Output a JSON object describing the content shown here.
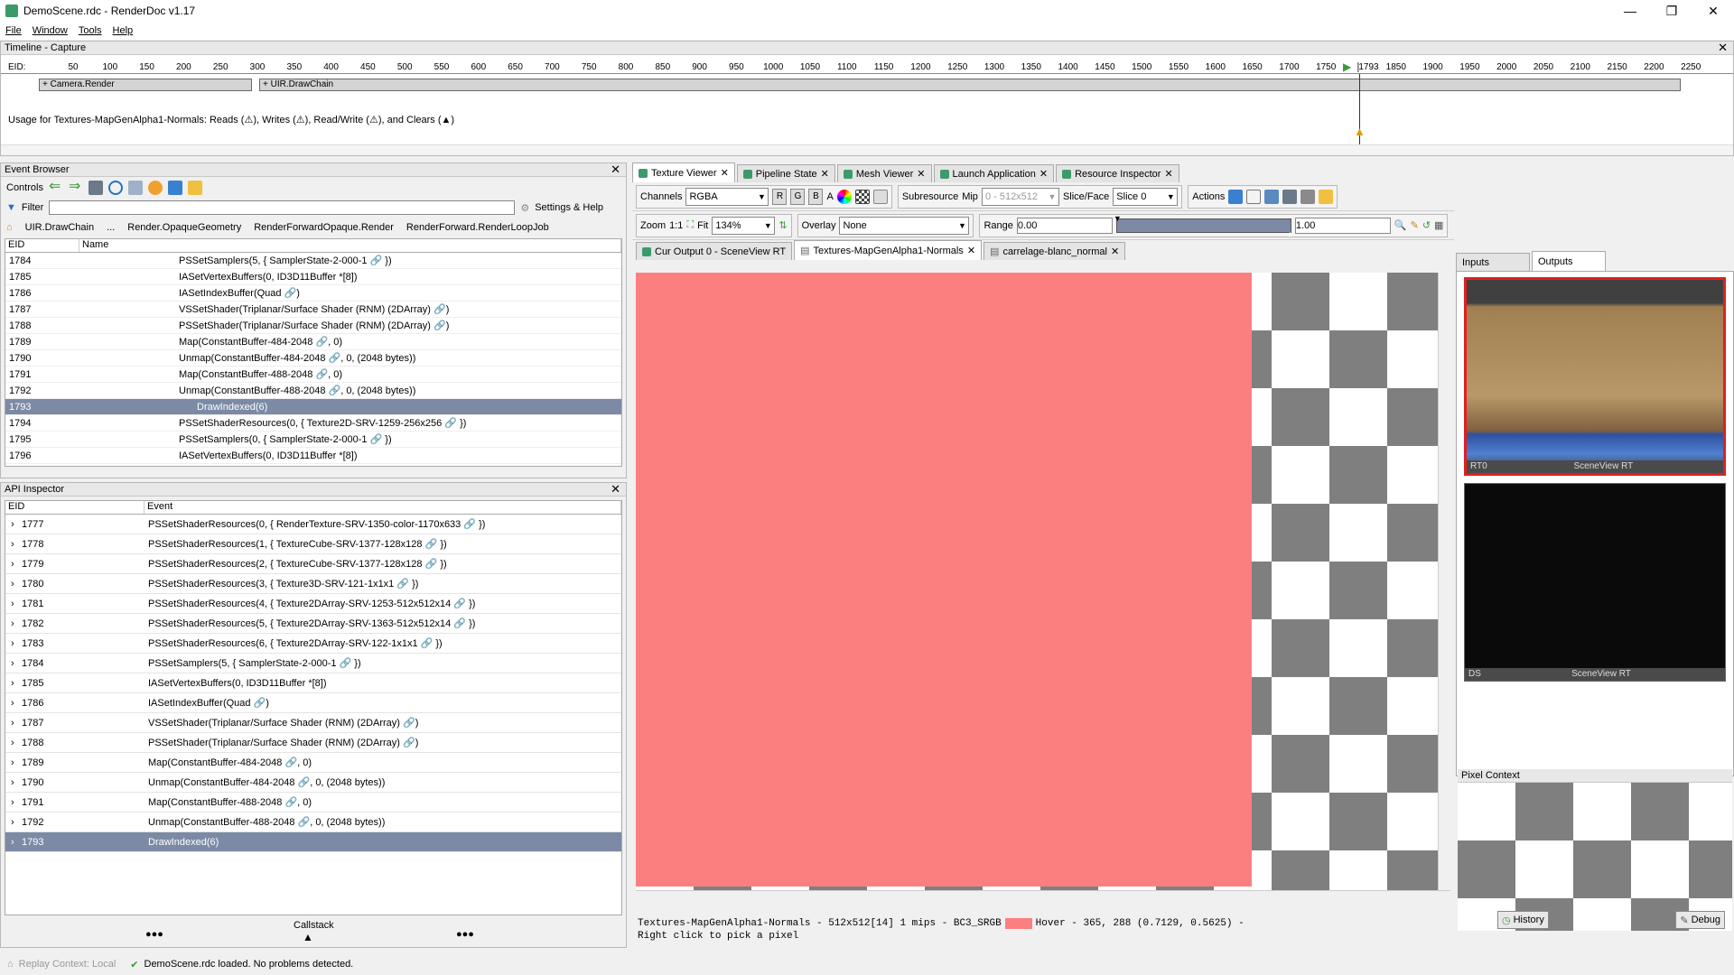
{
  "window": {
    "title": "DemoScene.rdc - RenderDoc v1.17",
    "minimize": "—",
    "maximize": "❐",
    "close": "✕"
  },
  "menu": [
    "File",
    "Window",
    "Tools",
    "Help"
  ],
  "timeline": {
    "panel_title": "Timeline - Capture",
    "eid_label": "EID:",
    "ticks": [
      "50",
      "100",
      "150",
      "200",
      "250",
      "300",
      "350",
      "400",
      "450",
      "500",
      "550",
      "600",
      "650",
      "700",
      "750",
      "800",
      "850",
      "900",
      "950",
      "1000",
      "1050",
      "1100",
      "1150",
      "1200",
      "1250",
      "1300",
      "1350",
      "1400",
      "1450",
      "1500",
      "1550",
      "1600",
      "1650",
      "1700",
      "1750",
      "1793",
      "1850",
      "1900",
      "1950",
      "2000",
      "2050",
      "2100",
      "2150",
      "2200",
      "2250"
    ],
    "sections": [
      "+ Camera.Render",
      "+ UIR.DrawChain"
    ],
    "usage_text": "Usage for Textures-MapGenAlpha1-Normals: Reads (⚠), Writes (⚠), Read/Write (⚠), and Clears (▲)"
  },
  "event_browser": {
    "panel_title": "Event Browser",
    "controls_label": "Controls",
    "filter_label": "Filter",
    "settings_label": "Settings & Help",
    "breadcrumbs": [
      "UIR.DrawChain",
      "...",
      "Render.OpaqueGeometry",
      "RenderForwardOpaque.Render",
      "RenderForward.RenderLoopJob"
    ],
    "col_eid": "EID",
    "col_name": "Name",
    "rows": [
      {
        "eid": "1784",
        "name": "PSSetSamplers(5, { SamplerState-2-000-1 🔗 })"
      },
      {
        "eid": "1785",
        "name": "IASetVertexBuffers(0, ID3D11Buffer *[8])"
      },
      {
        "eid": "1786",
        "name": "IASetIndexBuffer(Quad 🔗)"
      },
      {
        "eid": "1787",
        "name": "VSSetShader(Triplanar/Surface Shader (RNM) (2DArray) 🔗)"
      },
      {
        "eid": "1788",
        "name": "PSSetShader(Triplanar/Surface Shader (RNM) (2DArray) 🔗)"
      },
      {
        "eid": "1789",
        "name": "Map(ConstantBuffer-484-2048 🔗, 0)"
      },
      {
        "eid": "1790",
        "name": "Unmap(ConstantBuffer-484-2048 🔗, 0, (2048 bytes))"
      },
      {
        "eid": "1791",
        "name": "Map(ConstantBuffer-488-2048 🔗, 0)"
      },
      {
        "eid": "1792",
        "name": "Unmap(ConstantBuffer-488-2048 🔗, 0, (2048 bytes))"
      },
      {
        "eid": "1793",
        "name": "DrawIndexed(6)"
      },
      {
        "eid": "1794",
        "name": "PSSetShaderResources(0, { Texture2D-SRV-1259-256x256 🔗 })"
      },
      {
        "eid": "1795",
        "name": "PSSetSamplers(0, { SamplerState-2-000-1 🔗 })"
      },
      {
        "eid": "1796",
        "name": "IASetVertexBuffers(0, ID3D11Buffer *[8])"
      }
    ]
  },
  "api_inspector": {
    "panel_title": "API Inspector",
    "col_eid": "EID",
    "col_event": "Event",
    "rows": [
      {
        "eid": "1777",
        "event": "PSSetShaderResources(0, { RenderTexture-SRV-1350-color-1170x633 🔗 })"
      },
      {
        "eid": "1778",
        "event": "PSSetShaderResources(1, { TextureCube-SRV-1377-128x128 🔗 })"
      },
      {
        "eid": "1779",
        "event": "PSSetShaderResources(2, { TextureCube-SRV-1377-128x128 🔗 })"
      },
      {
        "eid": "1780",
        "event": "PSSetShaderResources(3, { Texture3D-SRV-121-1x1x1 🔗 })"
      },
      {
        "eid": "1781",
        "event": "PSSetShaderResources(4, { Texture2DArray-SRV-1253-512x512x14 🔗 })"
      },
      {
        "eid": "1782",
        "event": "PSSetShaderResources(5, { Texture2DArray-SRV-1363-512x512x14 🔗 })"
      },
      {
        "eid": "1783",
        "event": "PSSetShaderResources(6, { Texture2DArray-SRV-122-1x1x1 🔗 })"
      },
      {
        "eid": "1784",
        "event": "PSSetSamplers(5, { SamplerState-2-000-1 🔗 })"
      },
      {
        "eid": "1785",
        "event": "IASetVertexBuffers(0, ID3D11Buffer *[8])"
      },
      {
        "eid": "1786",
        "event": "IASetIndexBuffer(Quad 🔗)"
      },
      {
        "eid": "1787",
        "event": "VSSetShader(Triplanar/Surface Shader (RNM) (2DArray) 🔗)"
      },
      {
        "eid": "1788",
        "event": "PSSetShader(Triplanar/Surface Shader (RNM) (2DArray) 🔗)"
      },
      {
        "eid": "1789",
        "event": "Map(ConstantBuffer-484-2048 🔗, 0)"
      },
      {
        "eid": "1790",
        "event": "Unmap(ConstantBuffer-484-2048 🔗, 0, (2048 bytes))"
      },
      {
        "eid": "1791",
        "event": "Map(ConstantBuffer-488-2048 🔗, 0)"
      },
      {
        "eid": "1792",
        "event": "Unmap(ConstantBuffer-488-2048 🔗, 0, (2048 bytes))"
      },
      {
        "eid": "1793",
        "event": "DrawIndexed(6)"
      }
    ],
    "callstack_label": "Callstack",
    "more_left": "●●●",
    "more_right": "●●●"
  },
  "texture_viewer": {
    "tabs": [
      "Texture Viewer",
      "Pipeline State",
      "Mesh Viewer",
      "Launch Application",
      "Resource Inspector"
    ],
    "channels_label": "Channels",
    "channels_value": "RGBA",
    "ch_r": "R",
    "ch_g": "G",
    "ch_b": "B",
    "ch_a": "A",
    "subresource_label": "Subresource",
    "mip_label": "Mip",
    "mip_value": "0 - 512x512",
    "slice_label": "Slice/Face",
    "slice_value": "Slice 0",
    "actions_label": "Actions",
    "zoom_label": "Zoom",
    "zoom_1to1": "1:1",
    "fit_label": "Fit",
    "zoom_value": "134%",
    "overlay_label": "Overlay",
    "overlay_value": "None",
    "range_label": "Range",
    "range_min": "0.00",
    "range_max": "1.00",
    "subtabs": [
      "Cur Output 0 - SceneView RT",
      "Textures-MapGenAlpha1-Normals",
      "carrelage-blanc_normal"
    ],
    "status_line1": "Textures-MapGenAlpha1-Normals - 512x512[14] 1 mips - BC3_SRGB",
    "hover_text": "Hover -   365,  288 (0.7129, 0.5625)  -",
    "status_line2": "Right click to pick a pixel",
    "texture_color": "#fc7f7f"
  },
  "thumbnails": {
    "inputs_tab": "Inputs",
    "outputs_tab": "Outputs",
    "items": [
      {
        "slot": "RT0",
        "name": "SceneView RT"
      },
      {
        "slot": "DS",
        "name": "SceneView RT"
      }
    ]
  },
  "pixel_context": {
    "panel_title": "Pixel Context",
    "history_label": "History",
    "debug_label": "Debug"
  },
  "status": {
    "replay_context": "Replay Context: Local",
    "message": "DemoScene.rdc loaded. No problems detected."
  }
}
